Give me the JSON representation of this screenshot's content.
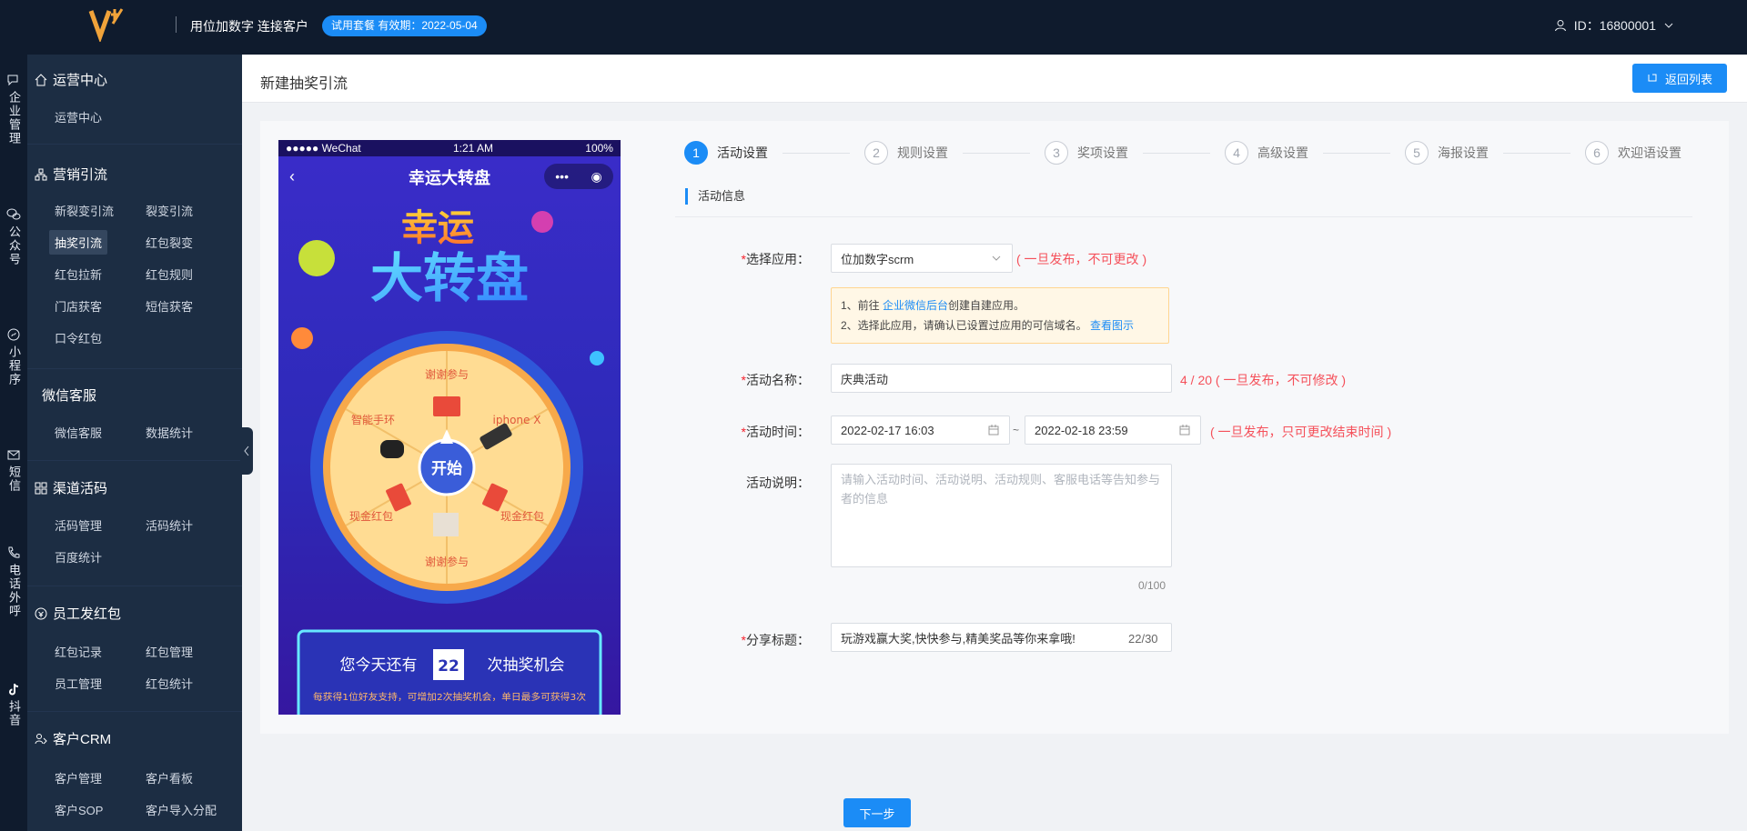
{
  "topbar": {
    "slogan": "用位加数字 连接客户",
    "trial_badge": "试用套餐  有效期：2022-05-04",
    "user_id": "ID：16800001"
  },
  "rail": [
    {
      "label": "企业管理",
      "icon": "chat-icon"
    },
    {
      "label": "公众号",
      "icon": "wechat-icon"
    },
    {
      "label": "小程序",
      "icon": "miniprogram-icon"
    },
    {
      "label": "短信",
      "icon": "mail-icon"
    },
    {
      "label": "电话外呼",
      "icon": "phone-icon"
    },
    {
      "label": "抖音",
      "icon": "tiktok-icon"
    }
  ],
  "sidebar": {
    "g1": {
      "title": "运营中心",
      "links": [
        "运营中心"
      ]
    },
    "g2": {
      "title": "营销引流",
      "links": [
        "新裂变引流",
        "裂变引流",
        "抽奖引流",
        "红包裂变",
        "红包拉新",
        "红包规则",
        "门店获客",
        "短信获客",
        "口令红包"
      ]
    },
    "g3": {
      "title": "微信客服",
      "links": [
        "微信客服",
        "数据统计"
      ]
    },
    "g4": {
      "title": "渠道活码",
      "links": [
        "活码管理",
        "活码统计",
        "百度统计"
      ]
    },
    "g5": {
      "title": "员工发红包",
      "links": [
        "红包记录",
        "红包管理",
        "员工管理",
        "红包统计"
      ]
    },
    "g6": {
      "title": "客户CRM",
      "links": [
        "客户管理",
        "客户看板",
        "客户SOP",
        "客户导入分配"
      ]
    }
  },
  "header": {
    "title": "新建抽奖引流",
    "back_label": "返回列表"
  },
  "phone": {
    "carrier": "●●●●● WeChat",
    "time": "1:21 AM",
    "battery": "100%",
    "title": "幸运大转盘",
    "hero_top": "幸运",
    "hero_main": "大转盘",
    "wheel_center": "开始",
    "prizes": [
      "谢谢参与",
      "iphone X",
      "谢谢参与",
      "现金红包",
      "现金红包",
      "智能手环"
    ],
    "chance_prefix": "您今天还有",
    "chance_count": "22",
    "chance_suffix": "次抽奖机会",
    "chance_note": "每获得1位好友支持，可增加2次抽奖机会，单日最多可获得3次"
  },
  "steps": [
    {
      "num": "1",
      "label": "活动设置"
    },
    {
      "num": "2",
      "label": "规则设置"
    },
    {
      "num": "3",
      "label": "奖项设置"
    },
    {
      "num": "4",
      "label": "高级设置"
    },
    {
      "num": "5",
      "label": "海报设置"
    },
    {
      "num": "6",
      "label": "欢迎语设置"
    }
  ],
  "form": {
    "section": "活动信息",
    "app_label": "选择应用：",
    "app_value": "位加数字scrm",
    "app_hint": "( 一旦发布，不可更改 )",
    "notice_line1_pre": "1、前往 ",
    "notice_line1_link": "企业微信后台",
    "notice_line1_post": "创建自建应用。",
    "notice_line2": "2、选择此应用，请确认已设置过应用的可信域名。",
    "notice_line2_link": "查看图示",
    "name_label": "活动名称：",
    "name_value": "庆典活动",
    "name_hint": "4 / 20 ( 一旦发布，不可修改 )",
    "time_label": "活动时间：",
    "time_start": "2022-02-17 16:03",
    "time_sep": "~",
    "time_end": "2022-02-18 23:59",
    "time_hint": "( 一旦发布，只可更改结束时间 )",
    "desc_label": "活动说明：",
    "desc_placeholder": "请输入活动时间、活动说明、活动规则、客服电话等告知参与者的信息",
    "desc_count": "0/100",
    "share_label": "分享标题：",
    "share_value": "玩游戏赢大奖,快快参与,精美奖品等你来拿哦!",
    "share_count": "22/30",
    "next_label": "下一步"
  },
  "colors": {
    "accent": "#1b8cf6",
    "nav": "#0f1b2d",
    "sidebar": "#1c2d43",
    "warning_text": "#f5505a"
  }
}
